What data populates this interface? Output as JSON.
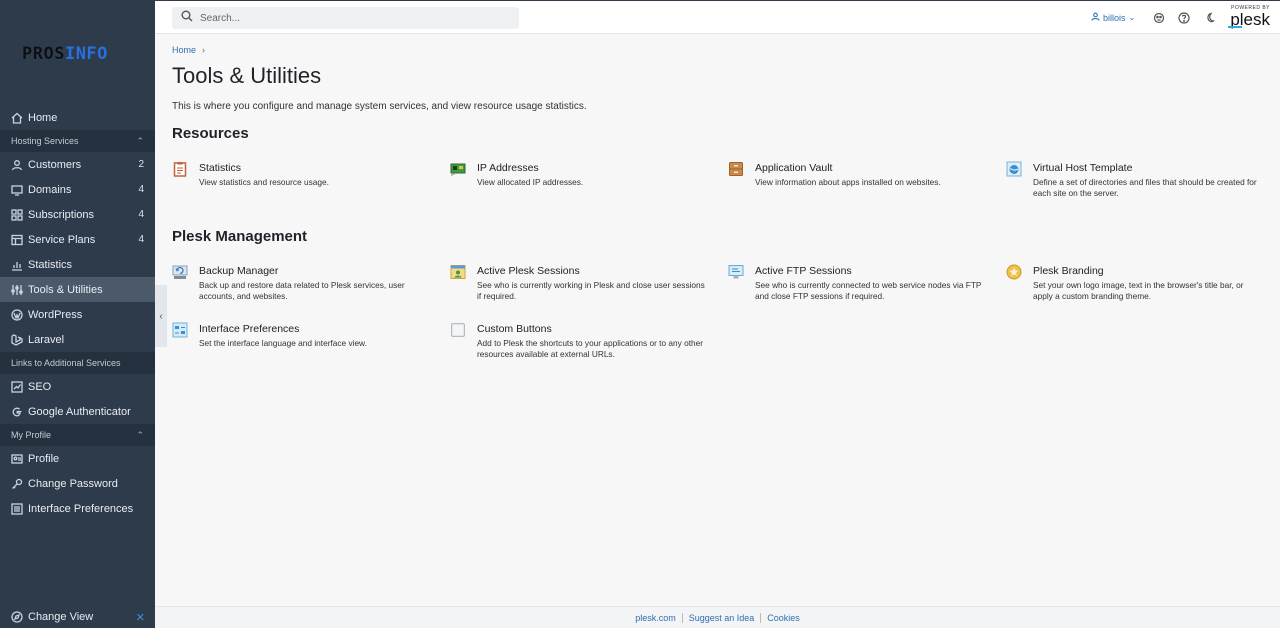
{
  "brand": {
    "logo_part1": "PROS",
    "logo_part2": "INFO",
    "powered_by": "POWERED BY",
    "plesk": "plesk"
  },
  "sidebar": {
    "items_top": [
      {
        "label": "Home",
        "icon": "home-icon"
      }
    ],
    "hosting_section": "Hosting Services",
    "hosting_items": [
      {
        "label": "Customers",
        "count": "2",
        "icon": "user-icon"
      },
      {
        "label": "Domains",
        "count": "4",
        "icon": "monitor-icon"
      },
      {
        "label": "Subscriptions",
        "count": "4",
        "icon": "grid-icon"
      },
      {
        "label": "Service Plans",
        "count": "4",
        "icon": "plan-icon"
      },
      {
        "label": "Statistics",
        "count": "",
        "icon": "chart-icon"
      },
      {
        "label": "Tools & Utilities",
        "count": "",
        "icon": "tools-icon",
        "active": true
      },
      {
        "label": "WordPress",
        "count": "",
        "icon": "wordpress-icon"
      },
      {
        "label": "Laravel",
        "count": "",
        "icon": "laravel-icon"
      }
    ],
    "links_section": "Links to Additional Services",
    "links_items": [
      {
        "label": "SEO",
        "icon": "seo-chart-icon"
      },
      {
        "label": "Google Authenticator",
        "icon": "google-icon"
      }
    ],
    "profile_section": "My Profile",
    "profile_items": [
      {
        "label": "Profile",
        "icon": "profile-card-icon"
      },
      {
        "label": "Change Password",
        "icon": "key-icon"
      },
      {
        "label": "Interface Preferences",
        "icon": "preferences-icon"
      }
    ],
    "change_view": "Change View"
  },
  "topbar": {
    "search_placeholder": "Search...",
    "user": "billois"
  },
  "main": {
    "breadcrumb": "Home",
    "title": "Tools & Utilities",
    "description": "This is where you configure and manage system services, and view resource usage statistics.",
    "resources_title": "Resources",
    "resources": [
      {
        "name": "Statistics",
        "desc": "View statistics and resource usage.",
        "icon": "statistics-clipboard-icon"
      },
      {
        "name": "IP Addresses",
        "desc": "View allocated IP addresses.",
        "icon": "network-card-icon"
      },
      {
        "name": "Application Vault",
        "desc": "View information about apps installed on websites.",
        "icon": "vault-cabinet-icon"
      },
      {
        "name": "Virtual Host Template",
        "desc": "Define a set of directories and files that should be created for each site on the server.",
        "icon": "globe-template-icon"
      }
    ],
    "management_title": "Plesk Management",
    "management": [
      {
        "name": "Backup Manager",
        "desc": "Back up and restore data related to Plesk services, user accounts, and websites.",
        "icon": "backup-drive-icon"
      },
      {
        "name": "Active Plesk Sessions",
        "desc": "See who is currently working in Plesk and close user sessions if required.",
        "icon": "sessions-window-icon"
      },
      {
        "name": "Active FTP Sessions",
        "desc": "See who is currently connected to web service nodes via FTP and close FTP sessions if required.",
        "icon": "ftp-monitor-icon"
      },
      {
        "name": "Plesk Branding",
        "desc": "Set your own logo image, text in the browser's title bar, or apply a custom branding theme.",
        "icon": "branding-star-icon"
      },
      {
        "name": "Interface Preferences",
        "desc": "Set the interface language and interface view.",
        "icon": "interface-preferences-icon"
      },
      {
        "name": "Custom Buttons",
        "desc": "Add to Plesk the shortcuts to your applications or to any other resources available at external URLs.",
        "icon": "custom-button-icon"
      }
    ]
  },
  "footer": {
    "links": [
      "plesk.com",
      "Suggest an Idea",
      "Cookies"
    ]
  },
  "colors": {
    "sidebar_bg": "#2e3b4b",
    "sidebar_active": "#4b5a6b",
    "accent": "#2f6fb3",
    "logo_blue": "#2a6fe0"
  }
}
